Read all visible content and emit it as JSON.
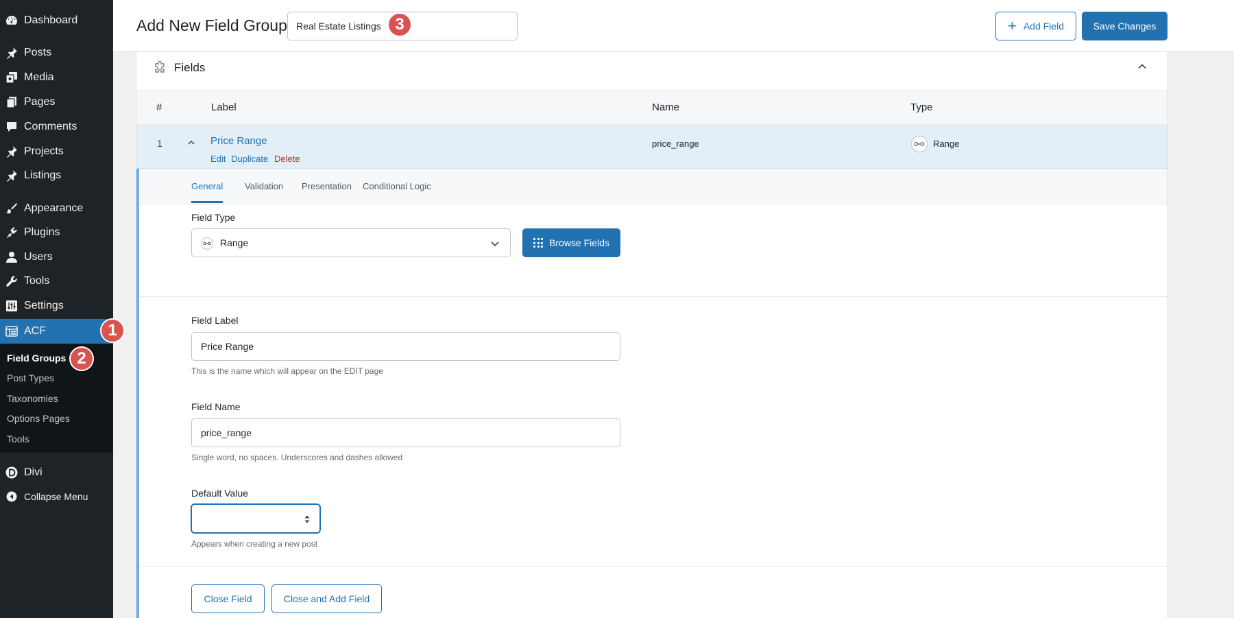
{
  "sidebar": {
    "items": [
      {
        "label": "Dashboard",
        "icon": "dashboard-icon"
      },
      {
        "label": "Posts",
        "icon": "pin-icon"
      },
      {
        "label": "Media",
        "icon": "media-icon"
      },
      {
        "label": "Pages",
        "icon": "pages-icon"
      },
      {
        "label": "Comments",
        "icon": "comment-icon"
      },
      {
        "label": "Projects",
        "icon": "pin-icon"
      },
      {
        "label": "Listings",
        "icon": "pin-icon"
      },
      {
        "label": "Appearance",
        "icon": "brush-icon"
      },
      {
        "label": "Plugins",
        "icon": "plugin-icon"
      },
      {
        "label": "Users",
        "icon": "user-icon"
      },
      {
        "label": "Tools",
        "icon": "wrench-icon"
      },
      {
        "label": "Settings",
        "icon": "settings-icon"
      },
      {
        "label": "ACF",
        "icon": "acf-icon"
      }
    ],
    "submenu": [
      "Field Groups",
      "Post Types",
      "Taxonomies",
      "Options Pages",
      "Tools"
    ],
    "divi": "Divi",
    "collapse": "Collapse Menu"
  },
  "badges": [
    "1",
    "2",
    "3"
  ],
  "header": {
    "title": "Add New Field Group",
    "group_title_value": "Real Estate Listings",
    "add_field": "Add Field",
    "save": "Save Changes"
  },
  "fields_panel": {
    "title": "Fields",
    "columns": [
      "#",
      "Label",
      "Name",
      "Type"
    ],
    "row": {
      "num": "1",
      "label": "Price Range",
      "actions": [
        "Edit",
        "Duplicate",
        "Delete"
      ],
      "name": "price_range",
      "type": "Range"
    }
  },
  "settings": {
    "tabs": [
      "General",
      "Validation",
      "Presentation",
      "Conditional Logic"
    ],
    "field_type_label": "Field Type",
    "field_type_value": "Range",
    "browse_fields": "Browse Fields",
    "field_label_label": "Field Label",
    "field_label_value": "Price Range",
    "field_label_help": "This is the name which will appear on the EDIT page",
    "field_name_label": "Field Name",
    "field_name_value": "price_range",
    "field_name_help": "Single word, no spaces. Underscores and dashes allowed",
    "default_value_label": "Default Value",
    "default_value_help": "Appears when creating a new post",
    "close_field": "Close Field",
    "close_and_add": "Close and Add Field"
  },
  "colors": {
    "sidebar_bg": "#1d2327",
    "accent": "#2271b1",
    "delete": "#b32d2e",
    "badge": "#d9534f"
  }
}
